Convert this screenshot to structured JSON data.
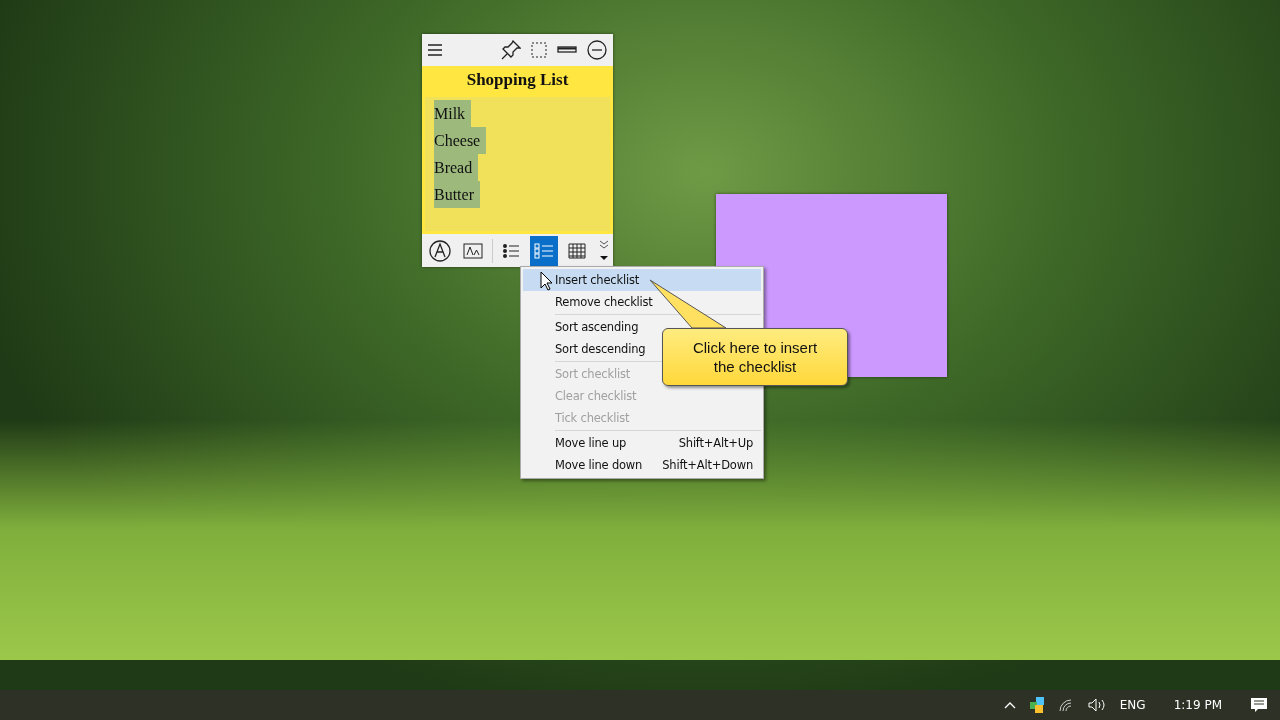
{
  "note": {
    "title": "Shopping List",
    "lines": [
      {
        "text": "Milk",
        "highlighted": true
      },
      {
        "text": "Cheese",
        "highlighted": true
      },
      {
        "text": "Bread",
        "highlighted": true
      },
      {
        "text": "Butter",
        "highlighted": true
      }
    ],
    "tools": [
      {
        "kind": "font",
        "selected": false
      },
      {
        "kind": "text-size",
        "selected": false
      },
      {
        "kind": "bullets",
        "selected": false
      },
      {
        "kind": "checklist",
        "selected": true
      },
      {
        "kind": "table",
        "selected": false
      }
    ]
  },
  "menu": [
    {
      "kind": "item",
      "label": "Insert checklist",
      "disabled": false,
      "selected": true
    },
    {
      "kind": "item",
      "label": "Remove checklist",
      "disabled": false,
      "selected": false
    },
    {
      "kind": "separator"
    },
    {
      "kind": "item",
      "label": "Sort ascending",
      "disabled": false,
      "selected": false
    },
    {
      "kind": "item",
      "label": "Sort descending",
      "disabled": false,
      "selected": false
    },
    {
      "kind": "separator"
    },
    {
      "kind": "item",
      "label": "Sort checklist",
      "disabled": true,
      "selected": false
    },
    {
      "kind": "item",
      "label": "Clear checklist",
      "disabled": true,
      "selected": false
    },
    {
      "kind": "item",
      "label": "Tick checklist",
      "disabled": true,
      "selected": false
    },
    {
      "kind": "separator"
    },
    {
      "kind": "item",
      "label": "Move line up",
      "shortcut": "Shift+Alt+Up",
      "disabled": false,
      "selected": false
    },
    {
      "kind": "item",
      "label": "Move line down",
      "shortcut": "Shift+Alt+Down",
      "disabled": false,
      "selected": false
    }
  ],
  "callout": {
    "text": "Click here to insert the checklist"
  },
  "second_note": {
    "color": "#cc99ff"
  },
  "taskbar": {
    "language": "ENG",
    "time": "1:19 PM"
  }
}
